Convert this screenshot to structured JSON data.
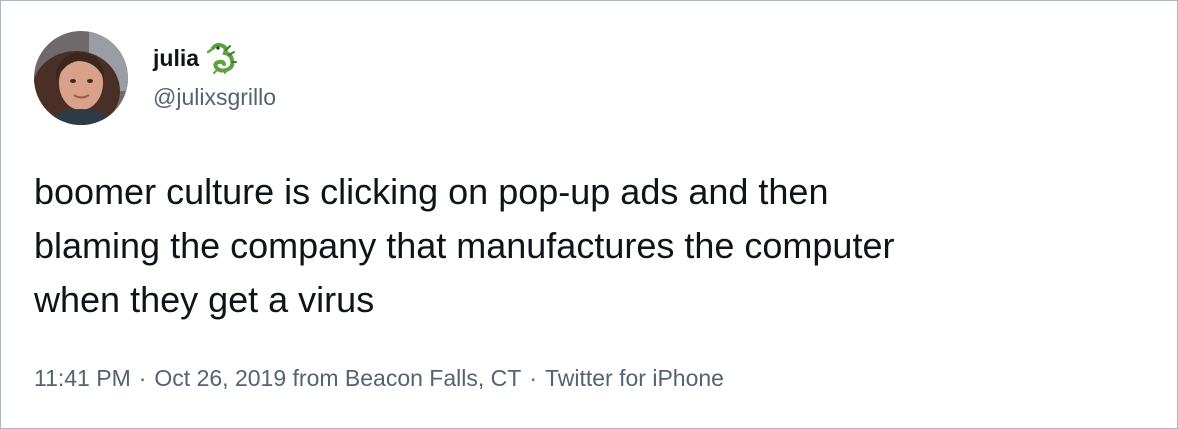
{
  "user": {
    "display_name": "julia",
    "handle": "@julixsgrillo",
    "emoji": "dragon-icon"
  },
  "tweet": {
    "text_lines": [
      "boomer culture is clicking on pop-up ads and then",
      "blaming the company that manufactures the computer",
      "when they get a virus"
    ]
  },
  "meta": {
    "time": "11:41 PM",
    "date": "Oct 26, 2019",
    "location_prefix": "from",
    "location": "Beacon Falls, CT",
    "source": "Twitter for iPhone",
    "separator": "·"
  },
  "colors": {
    "text": "#0f1419",
    "secondary": "#536471",
    "border": "#aab8c2",
    "dragon": "#5da13e"
  }
}
